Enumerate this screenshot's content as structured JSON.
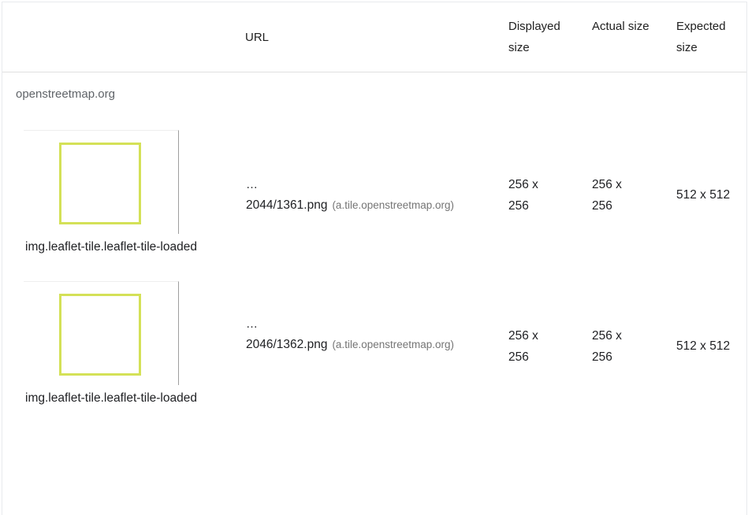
{
  "table": {
    "headers": {
      "resource": "",
      "url": "URL",
      "displayed_size": "Displayed size",
      "actual_size": "Actual size",
      "expected_size": "Expected size"
    },
    "group": {
      "label": "openstreetmap.org"
    },
    "rows": [
      {
        "selector": "img.leaflet-tile.leaflet-tile-loaded",
        "url_prefix": "…",
        "url_file": "2044/1361.png",
        "url_host": "(a.tile.openstreetmap.org)",
        "displayed_size": "256 x 256",
        "actual_size": "256 x 256",
        "expected_size": "512 x 512",
        "thumbnail_border_color": "#d4e157"
      },
      {
        "selector": "img.leaflet-tile.leaflet-tile-loaded",
        "url_prefix": "…",
        "url_file": "2046/1362.png",
        "url_host": "(a.tile.openstreetmap.org)",
        "displayed_size": "256 x 256",
        "actual_size": "256 x 256",
        "expected_size": "512 x 512",
        "thumbnail_border_color": "#d4e157"
      }
    ]
  }
}
